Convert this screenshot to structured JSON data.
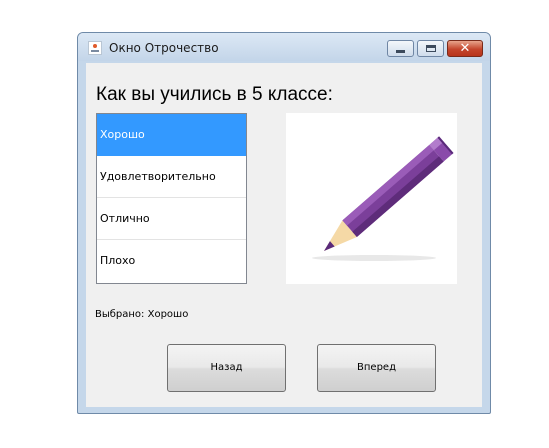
{
  "window": {
    "title": "Окно Отрочество",
    "icon": "app-icon",
    "controls": {
      "minimize": "minimize-icon",
      "maximize": "maximize-icon",
      "close": "close-icon",
      "close_glyph": "✕"
    }
  },
  "content": {
    "heading": "Как вы учились в 5 классе:",
    "options": [
      "Хорошо",
      "Удовлетворительно",
      "Отлично",
      "Плохо"
    ],
    "selected_index": 0,
    "picture": "pencil-illustration",
    "status": "Выбрано: Хорошо"
  },
  "buttons": {
    "back": "Назад",
    "next": "Вперед"
  },
  "colors": {
    "selection": "#3399ff",
    "pencil_body": "#7b3f9a",
    "pencil_wood": "#f5d9a6",
    "close_button": "#c4452c"
  }
}
